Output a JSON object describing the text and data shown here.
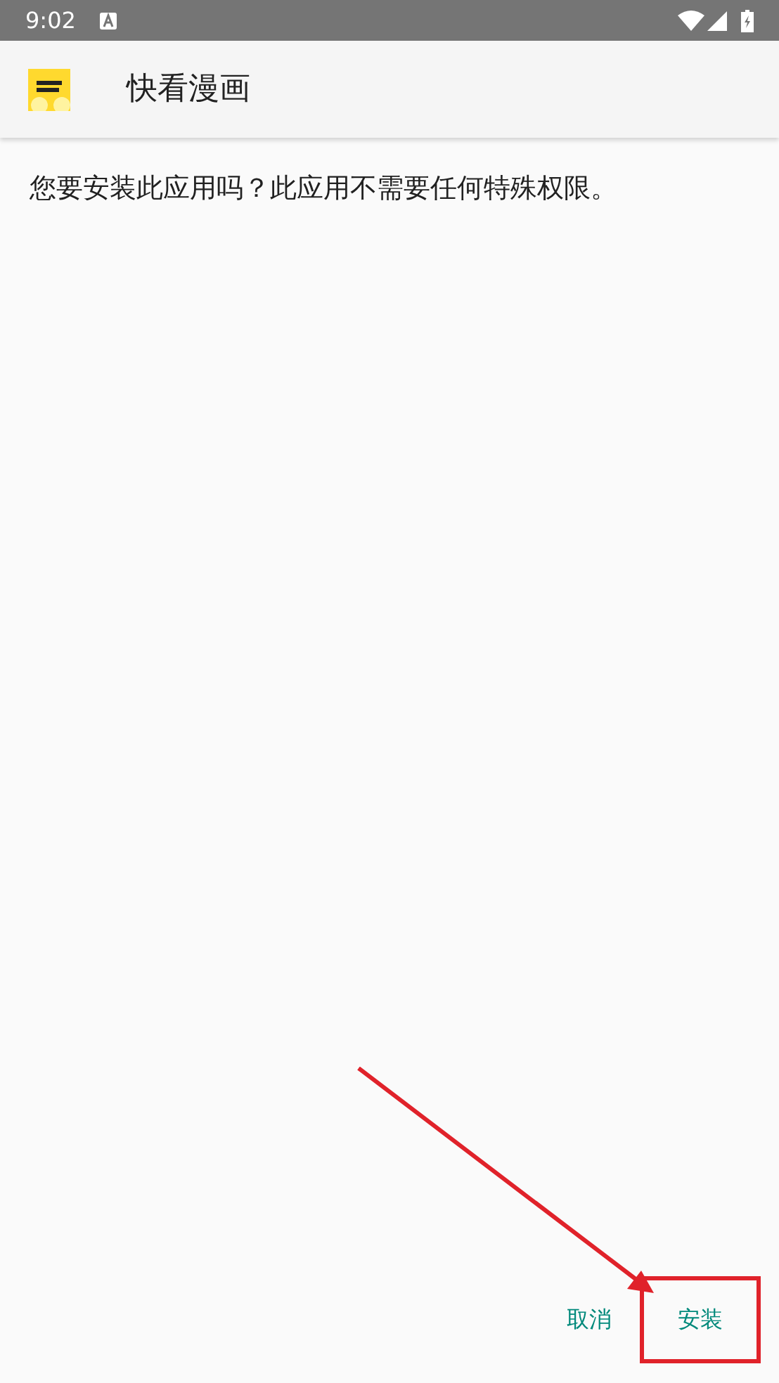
{
  "status_bar": {
    "time": "9:02"
  },
  "app_bar": {
    "title": "快看漫画"
  },
  "message": "您要安装此应用吗？此应用不需要任何特殊权限。",
  "buttons": [
    {
      "label": "取消",
      "highlighted": false
    },
    {
      "label": "安装",
      "highlighted": true
    }
  ]
}
